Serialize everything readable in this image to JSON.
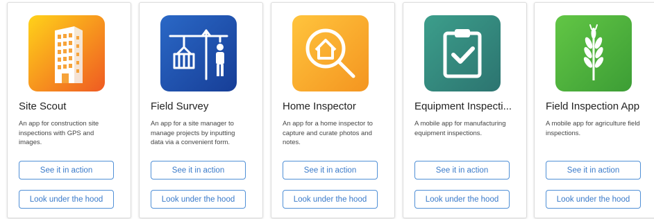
{
  "cards": [
    {
      "title": "Site Scout",
      "description": "An app for construction site inspections with GPS and images.",
      "icon": "building-icon",
      "colors": {
        "from": "#ffd21a",
        "to": "#ef5a22"
      },
      "action_label": "See it in action",
      "hood_label": "Look under the hood"
    },
    {
      "title": "Field Survey",
      "description": "An app for a site manager to manage projects by inputting data via a convenient form.",
      "icon": "crane-worker-icon",
      "colors": {
        "from": "#2a68c6",
        "to": "#173e97"
      },
      "action_label": "See it in action",
      "hood_label": "Look under the hood"
    },
    {
      "title": "Home Inspector",
      "description": "An app for a home inspector to capture and curate photos and notes.",
      "icon": "house-search-icon",
      "colors": {
        "from": "#ffc43d",
        "to": "#f49520"
      },
      "action_label": "See it in action",
      "hood_label": "Look under the hood"
    },
    {
      "title": "Equipment Inspecti...",
      "description": "A mobile app for manufacturing equipment inspections.",
      "icon": "clipboard-check-icon",
      "colors": {
        "from": "#3c9e8b",
        "to": "#2c7470"
      },
      "action_label": "See it in action",
      "hood_label": "Look under the hood"
    },
    {
      "title": "Field Inspection App",
      "description": "A mobile app for agriculture field inspections.",
      "icon": "wheat-icon",
      "colors": {
        "from": "#62c645",
        "to": "#3c9d35"
      },
      "action_label": "See it in action",
      "hood_label": "Look under the hood"
    }
  ]
}
